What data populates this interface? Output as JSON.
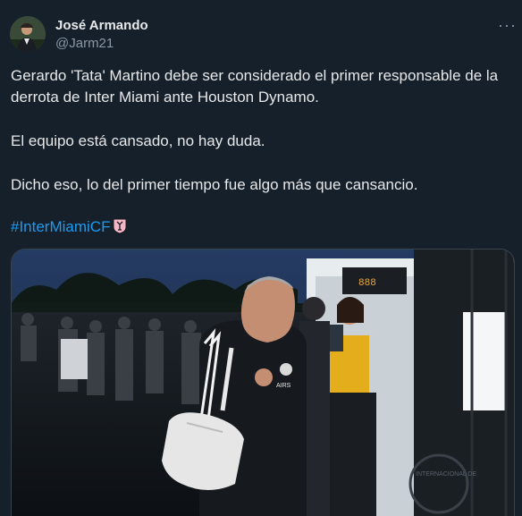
{
  "tweet": {
    "author_name": "José Armando",
    "author_handle": "@Jarm21",
    "more_label": "···",
    "paragraphs": [
      "Gerardo 'Tata' Martino debe ser considerado el primer responsable de la derrota de Inter Miami ante Houston Dynamo.",
      "El equipo está cansado, no hay duda.",
      "Dicho eso, lo del primer tiempo fue algo más que cansancio."
    ],
    "hashtag": "#InterMiamiCF",
    "hashtag_emoji_icon": "inter-miami-crest-icon",
    "media": {
      "scoreboard_text": "888",
      "shirt_text": "AIRS",
      "badge_text": "INTERNACIONAL DE"
    }
  },
  "colors": {
    "background": "#15202b",
    "text": "#e7e9ea",
    "secondary_text": "#8b98a5",
    "link": "#1d9bf0",
    "border": "#38444d"
  }
}
